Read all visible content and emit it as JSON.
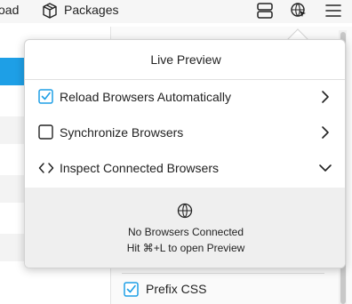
{
  "toolbar": {
    "partial_label": "oad",
    "packages_label": "Packages",
    "icons": [
      "packages-icon",
      "layout-toggle-icon",
      "live-preview-icon",
      "hamburger-menu-icon"
    ]
  },
  "popover": {
    "title": "Live Preview",
    "items": [
      {
        "label": "Reload Browsers Automatically",
        "checked": true,
        "trailing": "chevron-right-icon"
      },
      {
        "label": "Synchronize Browsers",
        "checked": false,
        "trailing": "chevron-right-icon"
      },
      {
        "label": "Inspect Connected Browsers",
        "leading": "code-brackets-icon",
        "trailing": "chevron-down-icon"
      }
    ],
    "status": {
      "icon": "globe-icon",
      "line1": "No Browsers Connected",
      "line2": "Hit ⌘+L to open Preview"
    }
  },
  "background": {
    "prefix_label": "Prefix CSS",
    "prefix_checked": true
  },
  "colors": {
    "accent": "#1e9fe6",
    "check": "#1e9fe6"
  }
}
